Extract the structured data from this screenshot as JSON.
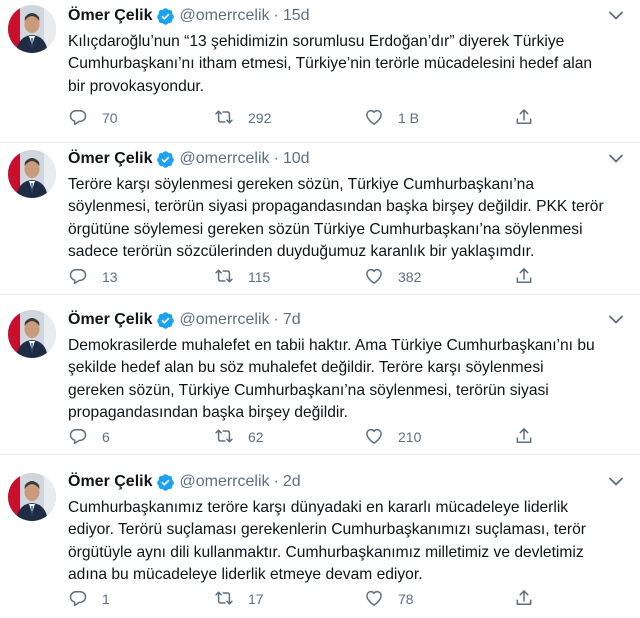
{
  "tweets": [
    {
      "name": "Ömer Çelik",
      "handle": "@omerrcelik",
      "separator": "·",
      "time": "15d",
      "text": "Kılıçdaroğlu’nun “13 şehidimizin sorumlusu Erdoğan’dır” diyerek Türkiye\nCumhurbaşkanı’nı itham etmesi, Türkiye’nin terörle mücadelesini hedef alan\nbir provokasyondur.",
      "replies": "70",
      "retweets": "292",
      "likes": "1 B"
    },
    {
      "name": "Ömer Çelik",
      "handle": "@omerrcelik",
      "separator": "·",
      "time": "10d",
      "text": "Teröre karşı söylenmesi gereken sözün, Türkiye Cumhurbaşkanı’na\nsöylenmesi, terörün siyasi propagandasından başka birşey değildir. PKK terör\nörgütüne söylemesi gereken sözün Türkiye Cumhurbaşkanı’na söylenmesi\nsadece terörün sözcülerinden duyduğumuz karanlık bir yaklaşımdır.",
      "replies": "13",
      "retweets": "115",
      "likes": "382"
    },
    {
      "name": "Ömer Çelik",
      "handle": "@omerrcelik",
      "separator": "·",
      "time": "7d",
      "text": "Demokrasilerde muhalefet en tabii haktır. Ama Türkiye Cumhurbaşkanı’nı bu\nşekilde hedef alan bu söz muhalefet değildir. Teröre karşı söylenmesi\ngereken sözün, Türkiye Cumhurbaşkanı’na söylenmesi, terörün siyasi\npropagandasından başka birşey değildir.",
      "replies": "6",
      "retweets": "62",
      "likes": "210"
    },
    {
      "name": "Ömer Çelik",
      "handle": "@omerrcelik",
      "separator": "·",
      "time": "2d",
      "text": "Cumhurbaşkanımız teröre karşı dünyadaki en kararlı mücadeleye liderlik\nediyor. Terörü suçlaması gerekenlerin Cumhurbaşkanımızı suçlaması, terör\nörgütüyle aynı dili kullanmaktır. Cumhurbaşkanımız milletimiz ve devletimiz\nadına bu mücadeleye liderlik etmeye devam ediyor.",
      "replies": "1",
      "retweets": "17",
      "likes": "78"
    }
  ],
  "colors": {
    "verified": "#1da1f2",
    "secondary_text": "#5b7083",
    "divider": "#e6ecf0"
  },
  "icons": {
    "reply": "speech-bubble",
    "retweet": "retweet-arrows",
    "like": "heart-outline",
    "share": "share-upload",
    "more": "chevron-down",
    "verified": "verified-badge"
  }
}
